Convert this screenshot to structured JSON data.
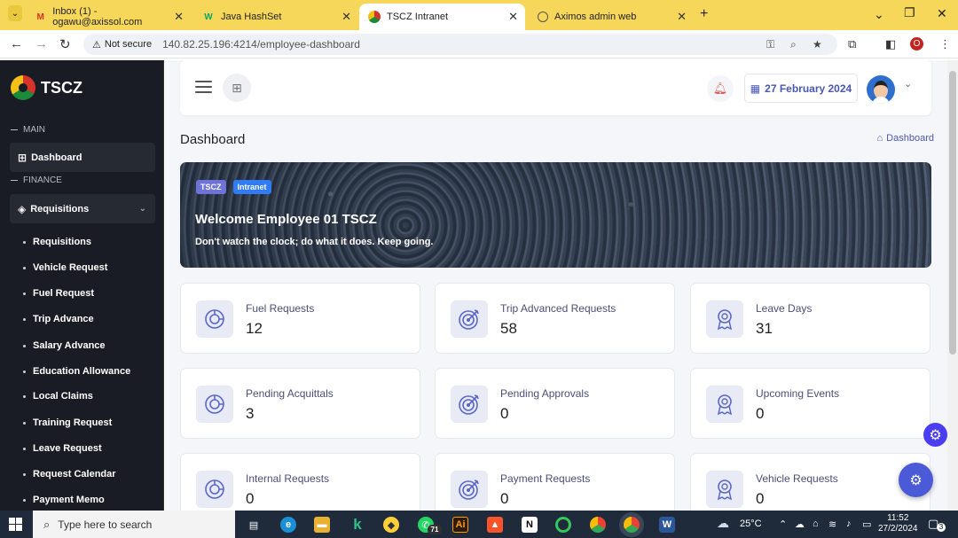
{
  "browser": {
    "tabs": [
      {
        "title": "Inbox (1) - ogawu@axissol.com",
        "icon": "gmail-icon"
      },
      {
        "title": "Java HashSet",
        "icon": "w3schools-icon"
      },
      {
        "title": "TSCZ Intranet",
        "icon": "tscz-icon",
        "active": true
      },
      {
        "title": "Aximos admin web",
        "icon": "globe-icon"
      }
    ],
    "not_secure": "Not secure",
    "url": "140.82.25.196:4214/employee-dashboard",
    "profile_initial": "O"
  },
  "sidebar": {
    "brand": "TSCZ",
    "section_main": "MAIN",
    "dashboard_label": "Dashboard",
    "section_finance": "FINANCE",
    "requisitions_label": "Requisitions",
    "subitems": [
      "Requisitions",
      "Vehicle Request",
      "Fuel Request",
      "Trip Advance",
      "Salary Advance",
      "Education Allowance",
      "Local Claims",
      "Training Request",
      "Leave Request",
      "Request Calendar",
      "Payment Memo"
    ]
  },
  "header": {
    "date": "27 February 2024"
  },
  "page": {
    "title": "Dashboard",
    "breadcrumb": "Dashboard"
  },
  "banner": {
    "badge1": "TSCZ",
    "badge2": "Intranet",
    "welcome": "Welcome Employee 01 TSCZ",
    "quote": "Don't watch the clock; do what it does. Keep going."
  },
  "stats": [
    {
      "label": "Fuel Requests",
      "value": "12",
      "icon": "pie-chart-icon"
    },
    {
      "label": "Trip Advanced Requests",
      "value": "58",
      "icon": "target-icon"
    },
    {
      "label": "Leave Days",
      "value": "31",
      "icon": "award-icon"
    },
    {
      "label": "Pending Acquittals",
      "value": "3",
      "icon": "pie-chart-icon"
    },
    {
      "label": "Pending Approvals",
      "value": "0",
      "icon": "target-icon"
    },
    {
      "label": "Upcoming Events",
      "value": "0",
      "icon": "award-icon"
    },
    {
      "label": "Internal Requests",
      "value": "0",
      "icon": "pie-chart-icon"
    },
    {
      "label": "Payment Requests",
      "value": "0",
      "icon": "target-icon"
    },
    {
      "label": "Vehicle Requests",
      "value": "0",
      "icon": "award-icon"
    }
  ],
  "taskbar": {
    "search_placeholder": "Type here to search",
    "whatsapp_badge": "71",
    "weather": "25°C",
    "time": "11:52",
    "date": "27/2/2024",
    "notifications": "3"
  },
  "colors": {
    "tab_bar": "#f6d75a",
    "sidebar": "#191c24",
    "accent": "#4a57b6",
    "badge_tscz": "#6f73d8",
    "badge_intranet": "#2f7cf6"
  }
}
